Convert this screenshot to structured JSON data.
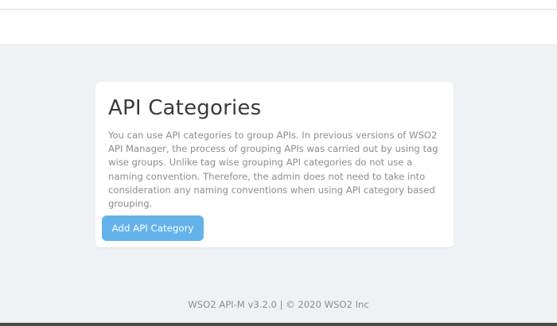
{
  "card": {
    "title": "API Categories",
    "description": "You can use API categories to group APIs. In previous versions of WSO2 API Manager, the process of grouping APIs was carried out by using tag wise groups. Unlike tag wise grouping API categories do not use a naming convention. Therefore, the admin does not need to take into consideration any naming conventions when using API category based grouping.",
    "add_button_label": "Add API Category"
  },
  "footer": {
    "text": "WSO2 API-M v3.2.0 | © 2020 WSO2 Inc"
  },
  "colors": {
    "page_background": "#eef2f5",
    "primary_button": "#63b3ea",
    "bottom_bar": "#4a4a4a"
  }
}
